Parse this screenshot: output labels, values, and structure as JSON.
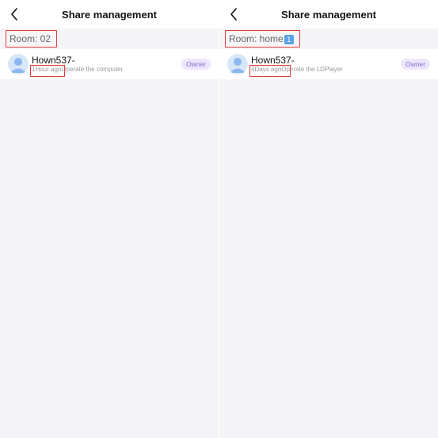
{
  "screens": [
    {
      "title": "Share management",
      "room_label": "Room: 02",
      "room_badge": "",
      "member": {
        "name": "Hown537-",
        "time": "1Hour ago",
        "action": "Operate the computer",
        "role": "Owner"
      }
    },
    {
      "title": "Share management",
      "room_label": "Room: home",
      "room_badge": "1",
      "member": {
        "name": "Hown537-",
        "time": "4Days ago",
        "action": "Operate the LDPlayer",
        "role": "Owner"
      }
    }
  ],
  "icons": {
    "back": "chevron-left-icon",
    "avatar": "user-avatar-icon"
  },
  "colors": {
    "background": "#f5f5f7",
    "owner_bg": "#ece5fb",
    "owner_text": "#8a6fd6",
    "highlight": "#e23b3b",
    "avatar": "#8db8ee"
  }
}
